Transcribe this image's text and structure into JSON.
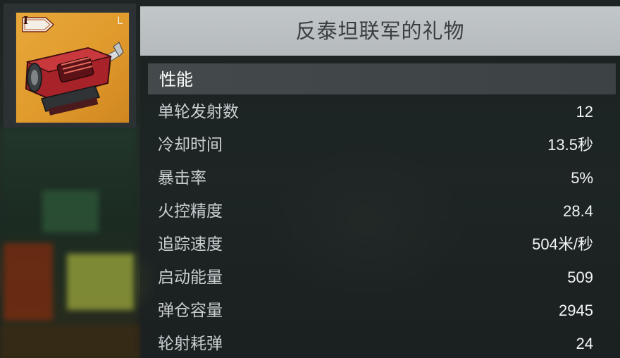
{
  "item": {
    "tier": "I",
    "slot": "L",
    "title": "反泰坦联军的礼物",
    "tile_color": "#e8a83a",
    "icon": "rocket-launcher-weapon-icon"
  },
  "section": {
    "label": "性能"
  },
  "stats": [
    {
      "label": "单轮发射数",
      "value": "12"
    },
    {
      "label": "冷却时间",
      "value": "13.5秒"
    },
    {
      "label": "暴击率",
      "value": "5%"
    },
    {
      "label": "火控精度",
      "value": "28.4"
    },
    {
      "label": "追踪速度",
      "value": "504米/秒"
    },
    {
      "label": "启动能量",
      "value": "509"
    },
    {
      "label": "弹仓容量",
      "value": "2945"
    },
    {
      "label": "轮射耗弹",
      "value": "24"
    }
  ]
}
